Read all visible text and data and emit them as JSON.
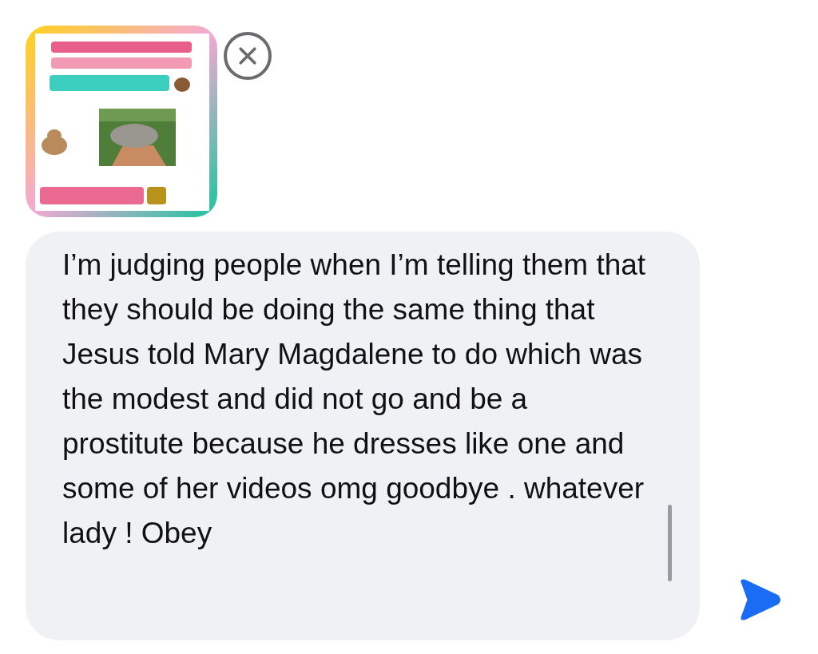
{
  "message": {
    "text": "I’m judging people when I’m telling them that they should be doing the same thing that Jesus told Mary Magdalene to do which was the modest and did not go and be a prostitute because he dresses like one and some of her videos omg goodbye . whatever lady ! Obey"
  }
}
